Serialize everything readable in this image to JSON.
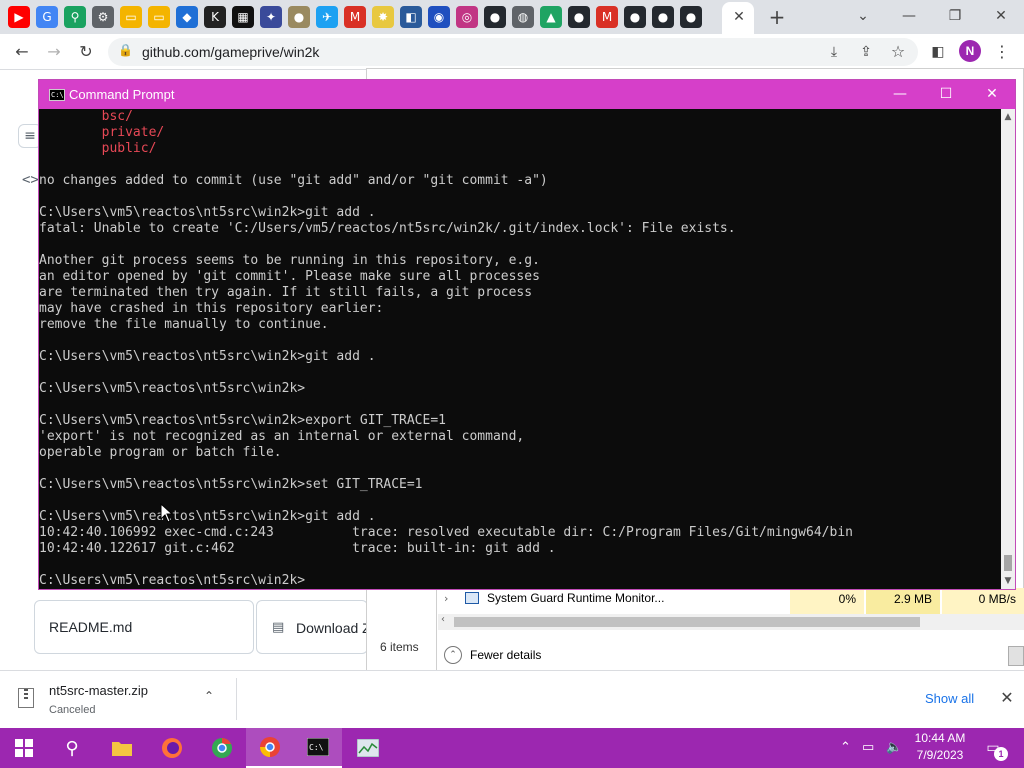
{
  "browser": {
    "url": "github.com/gameprive/win2k",
    "profile_initial": "N",
    "tab_favicons": [
      {
        "name": "youtube-icon",
        "glyph": "▶",
        "color": "#ff0000"
      },
      {
        "name": "google-icon",
        "glyph": "G",
        "color": "#4285f4"
      },
      {
        "name": "maps-pin-icon",
        "glyph": "⚲",
        "color": "#1aa260"
      },
      {
        "name": "gear-icon",
        "glyph": "⚙",
        "color": "#5f6368"
      },
      {
        "name": "folder-icon",
        "glyph": "▭",
        "color": "#f4b400"
      },
      {
        "name": "folder-icon",
        "glyph": "▭",
        "color": "#f4b400"
      },
      {
        "name": "bookmark-icon",
        "glyph": "◆",
        "color": "#1f6fd6"
      },
      {
        "name": "kim-icon",
        "glyph": "K",
        "color": "#222222"
      },
      {
        "name": "grid-icon",
        "glyph": "▦",
        "color": "#111111"
      },
      {
        "name": "app-icon",
        "glyph": "✦",
        "color": "#3a4a9a"
      },
      {
        "name": "circle-icon",
        "glyph": "●",
        "color": "#9a8a60"
      },
      {
        "name": "twitter-icon",
        "glyph": "✈",
        "color": "#1da1f2"
      },
      {
        "name": "gmail-icon",
        "glyph": "M",
        "color": "#d93025"
      },
      {
        "name": "bulb-icon",
        "glyph": "✸",
        "color": "#e8c840"
      },
      {
        "name": "app-icon",
        "glyph": "◧",
        "color": "#2a5a9a"
      },
      {
        "name": "sonic-icon",
        "glyph": "◉",
        "color": "#1f4fbf"
      },
      {
        "name": "instagram-icon",
        "glyph": "◎",
        "color": "#c13584"
      },
      {
        "name": "github-icon",
        "glyph": "●",
        "color": "#24292f"
      },
      {
        "name": "chrome-icon",
        "glyph": "◍",
        "color": "#5f6368"
      },
      {
        "name": "drive-icon",
        "glyph": "▲",
        "color": "#1fa463"
      },
      {
        "name": "github-icon",
        "glyph": "●",
        "color": "#24292f"
      },
      {
        "name": "gmail-icon",
        "glyph": "M",
        "color": "#d93025"
      },
      {
        "name": "github-icon",
        "glyph": "●",
        "color": "#24292f"
      },
      {
        "name": "github-icon",
        "glyph": "●",
        "color": "#24292f"
      },
      {
        "name": "github-icon",
        "glyph": "●",
        "color": "#24292f"
      }
    ]
  },
  "page": {
    "readme_tab": "README.md",
    "download_button": "Download ZIP"
  },
  "task_manager": {
    "items_count": "6 items",
    "row_name": "System Guard Runtime Monitor...",
    "row_cpu": "0%",
    "row_memory": "2.9 MB",
    "row_disk": "0 MB/s",
    "fewer_details": "Fewer details"
  },
  "cmd": {
    "title": "Command Prompt",
    "lines": [
      {
        "text": "        bsc/",
        "color": "red"
      },
      {
        "text": "        private/",
        "color": "red"
      },
      {
        "text": "        public/",
        "color": "red"
      },
      {
        "text": "",
        "color": "gray"
      },
      {
        "text": "no changes added to commit (use \"git add\" and/or \"git commit -a\")",
        "color": "gray"
      },
      {
        "text": "",
        "color": "gray"
      },
      {
        "text": "C:\\Users\\vm5\\reactos\\nt5src\\win2k>git add .",
        "color": "gray"
      },
      {
        "text": "fatal: Unable to create 'C:/Users/vm5/reactos/nt5src/win2k/.git/index.lock': File exists.",
        "color": "gray"
      },
      {
        "text": "",
        "color": "gray"
      },
      {
        "text": "Another git process seems to be running in this repository, e.g.",
        "color": "gray"
      },
      {
        "text": "an editor opened by 'git commit'. Please make sure all processes",
        "color": "gray"
      },
      {
        "text": "are terminated then try again. If it still fails, a git process",
        "color": "gray"
      },
      {
        "text": "may have crashed in this repository earlier:",
        "color": "gray"
      },
      {
        "text": "remove the file manually to continue.",
        "color": "gray"
      },
      {
        "text": "",
        "color": "gray"
      },
      {
        "text": "C:\\Users\\vm5\\reactos\\nt5src\\win2k>git add .",
        "color": "gray"
      },
      {
        "text": "",
        "color": "gray"
      },
      {
        "text": "C:\\Users\\vm5\\reactos\\nt5src\\win2k>",
        "color": "gray"
      },
      {
        "text": "",
        "color": "gray"
      },
      {
        "text": "C:\\Users\\vm5\\reactos\\nt5src\\win2k>export GIT_TRACE=1",
        "color": "gray"
      },
      {
        "text": "'export' is not recognized as an internal or external command,",
        "color": "gray"
      },
      {
        "text": "operable program or batch file.",
        "color": "gray"
      },
      {
        "text": "",
        "color": "gray"
      },
      {
        "text": "C:\\Users\\vm5\\reactos\\nt5src\\win2k>set GIT_TRACE=1",
        "color": "gray"
      },
      {
        "text": "",
        "color": "gray"
      },
      {
        "text": "C:\\Users\\vm5\\reactos\\nt5src\\win2k>git add .",
        "color": "gray"
      },
      {
        "text": "10:42:40.106992 exec-cmd.c:243          trace: resolved executable dir: C:/Program Files/Git/mingw64/bin",
        "color": "gray"
      },
      {
        "text": "10:42:40.122617 git.c:462               trace: built-in: git add .",
        "color": "gray"
      },
      {
        "text": "",
        "color": "gray"
      },
      {
        "text": "C:\\Users\\vm5\\reactos\\nt5src\\win2k>",
        "color": "gray"
      }
    ]
  },
  "downloads": {
    "file_name": "nt5src-master.zip",
    "status": "Canceled",
    "show_all": "Show all"
  },
  "taskbar": {
    "time": "10:44 AM",
    "date": "7/9/2023",
    "notification_count": "1",
    "accent": "#9c27b0"
  }
}
